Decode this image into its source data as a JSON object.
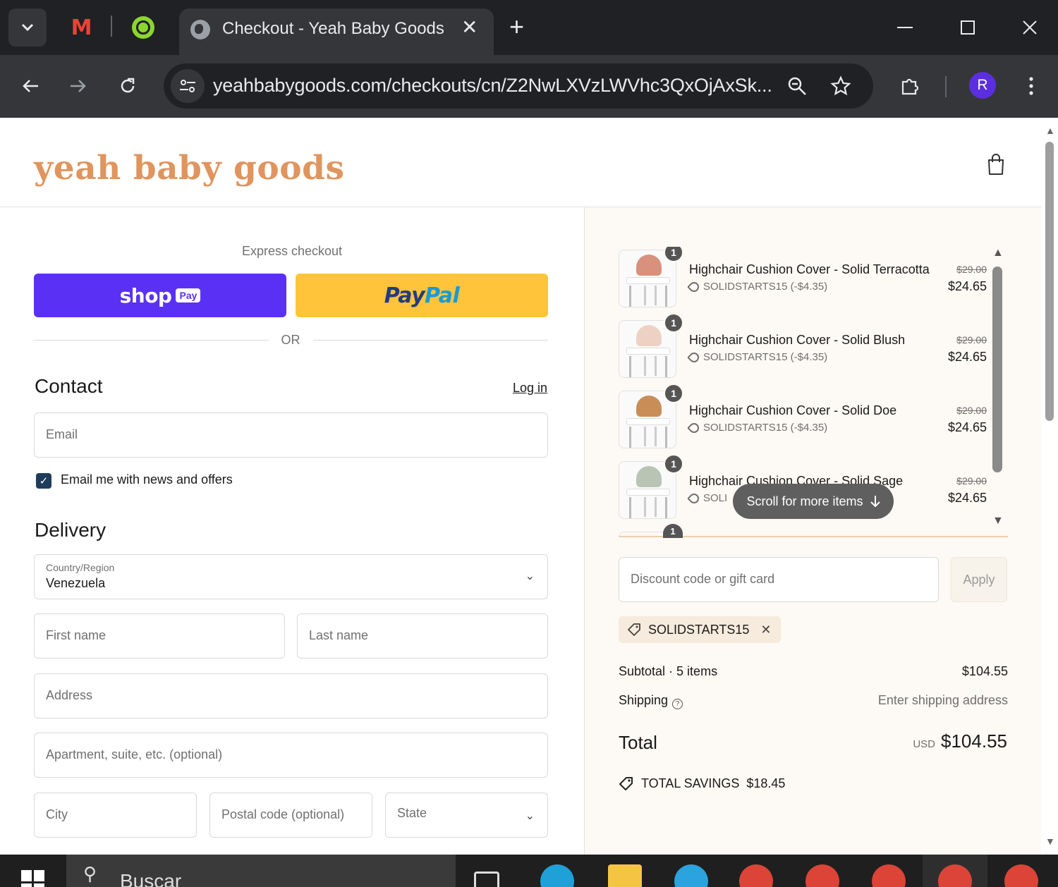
{
  "browser": {
    "tab_title": "Checkout - Yeah Baby Goods",
    "url": "yeahbabygoods.com/checkouts/cn/Z2NwLXVzLWVhc3QxOjAxSk...",
    "profile_initial": "R",
    "icons": {
      "tab_search": "chevron-down-icon",
      "pinned1": "gmail-icon",
      "pinned2": "green-app-icon",
      "tab_favicon": "globe-icon",
      "close_tab": "close-icon",
      "new_tab": "plus-icon",
      "minimize": "minimize-icon",
      "maximize": "maximize-icon",
      "close_window": "close-icon",
      "back": "arrow-left-icon",
      "forward": "arrow-right-icon",
      "reload": "reload-icon",
      "site_info": "tune-icon",
      "zoom": "zoom-icon",
      "bookmark": "star-icon",
      "extensions": "puzzle-icon",
      "menu": "kebab-menu-icon"
    }
  },
  "store": {
    "brand": "yeah baby goods",
    "brand_color": "#e0955e",
    "cart_icon": "shopping-bag-icon"
  },
  "express": {
    "label": "Express checkout",
    "shop_label": "shop",
    "shop_badge": "Pay",
    "shop_color": "#5a31f4",
    "paypal_part1": "Pay",
    "paypal_part2": "Pal",
    "paypal_color": "#ffc439",
    "or_text": "OR"
  },
  "contact": {
    "title": "Contact",
    "login": "Log in",
    "email_placeholder": "Email",
    "newsletter_checked": true,
    "newsletter_label": "Email me with news and offers"
  },
  "delivery": {
    "title": "Delivery",
    "country_label": "Country/Region",
    "country_value": "Venezuela",
    "first_name_placeholder": "First name",
    "last_name_placeholder": "Last name",
    "address_placeholder": "Address",
    "apartment_placeholder": "Apartment, suite, etc. (optional)",
    "city_placeholder": "City",
    "postal_placeholder": "Postal code (optional)",
    "state_placeholder": "State"
  },
  "summary": {
    "items": [
      {
        "name": "Highchair Cushion Cover - Solid Terracotta",
        "discount": "SOLIDSTARTS15 (-$4.35)",
        "old_price": "$29.00",
        "price": "$24.65",
        "qty": "1",
        "color": "#d9907c"
      },
      {
        "name": "Highchair Cushion Cover - Solid Blush",
        "discount": "SOLIDSTARTS15 (-$4.35)",
        "old_price": "$29.00",
        "price": "$24.65",
        "qty": "1",
        "color": "#edd2c4"
      },
      {
        "name": "Highchair Cushion Cover - Solid Doe",
        "discount": "SOLIDSTARTS15 (-$4.35)",
        "old_price": "$29.00",
        "price": "$24.65",
        "qty": "1",
        "color": "#c98e58"
      },
      {
        "name": "Highchair Cushion Cover - Solid Sage",
        "discount": "SOLI",
        "old_price": "$29.00",
        "price": "$24.65",
        "qty": "1",
        "color": "#b9c4b4"
      }
    ],
    "fifth_item_qty": "1",
    "scroll_hint": "Scroll for more items",
    "discount_placeholder": "Discount code or gift card",
    "apply_label": "Apply",
    "applied_code": "SOLIDSTARTS15",
    "subtotal_label": "Subtotal · 5 items",
    "subtotal_value": "$104.55",
    "shipping_label": "Shipping",
    "shipping_value": "Enter shipping address",
    "total_label": "Total",
    "currency": "USD",
    "total_value": "$104.55",
    "savings_label": "TOTAL SAVINGS",
    "savings_value": "$18.45"
  },
  "taskbar": {
    "search_text": "Buscar"
  }
}
